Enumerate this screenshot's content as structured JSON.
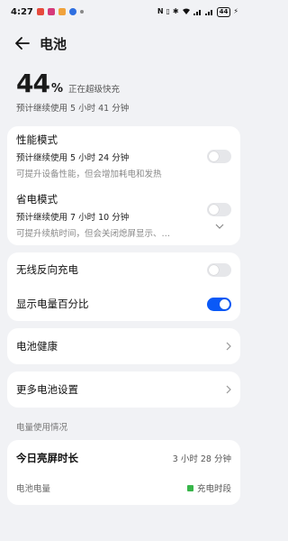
{
  "status_bar": {
    "time": "4:27",
    "battery": "44",
    "notification_colors": [
      "#e64a3c",
      "#d63a7a",
      "#f0a23c",
      "#2f6fe0"
    ],
    "icons": [
      "nfc-icon",
      "vibrate-icon",
      "bluetooth-icon",
      "wifi-icon",
      "signal-icon",
      "signal-icon",
      "battery-icon",
      "charging-icon"
    ]
  },
  "header": {
    "title": "电池"
  },
  "summary": {
    "percent": "44",
    "unit": "%",
    "status": "正在超级快充",
    "estimate": "预计继续使用 5 小时 41 分钟"
  },
  "performance_mode": {
    "title": "性能模式",
    "estimate": "预计继续使用 5 小时 24 分钟",
    "description": "可提升设备性能，但会增加耗电和发热",
    "enabled": false
  },
  "power_saving_mode": {
    "title": "省电模式",
    "estimate": "预计继续使用 7 小时 10 分钟",
    "description": "可提升续航时间，但会关闭熄屏显示、…",
    "enabled": false
  },
  "reverse_charging": {
    "title": "无线反向充电",
    "enabled": false
  },
  "show_percentage": {
    "title": "显示电量百分比",
    "enabled": true
  },
  "battery_health": {
    "title": "电池健康"
  },
  "more_settings": {
    "title": "更多电池设置"
  },
  "usage": {
    "section_label": "电量使用情况",
    "screen_on_title": "今日亮屏时长",
    "screen_on_value": "3 小时 28 分钟",
    "battery_level_label": "电池电量",
    "legend_charging": "充电时段"
  },
  "colors": {
    "accent": "#0a59f7",
    "charging_green": "#38b64a"
  }
}
